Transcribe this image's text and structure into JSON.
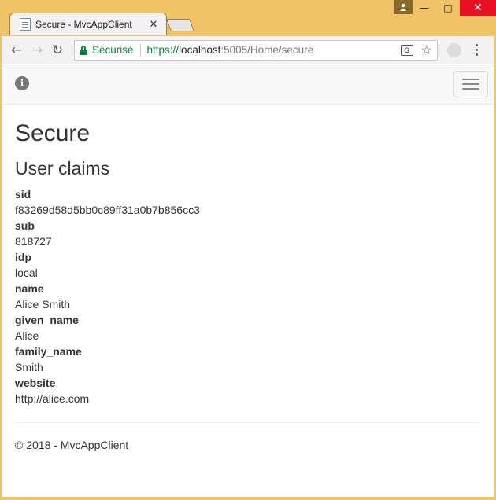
{
  "browser": {
    "tab_title": "Secure - MvcAppClient",
    "secure_label": "Sécurisé",
    "url_scheme": "https://",
    "url_host": "localhost",
    "url_rest": ":5005/Home/secure"
  },
  "page": {
    "title": "Secure",
    "subtitle": "User claims",
    "claims": [
      {
        "type": "sid",
        "value": "f83269d58d5bb0c89ff31a0b7b856cc3"
      },
      {
        "type": "sub",
        "value": "818727"
      },
      {
        "type": "idp",
        "value": "local"
      },
      {
        "type": "name",
        "value": "Alice Smith"
      },
      {
        "type": "given_name",
        "value": "Alice"
      },
      {
        "type": "family_name",
        "value": "Smith"
      },
      {
        "type": "website",
        "value": "http://alice.com"
      }
    ],
    "footer": "© 2018 - MvcAppClient"
  }
}
